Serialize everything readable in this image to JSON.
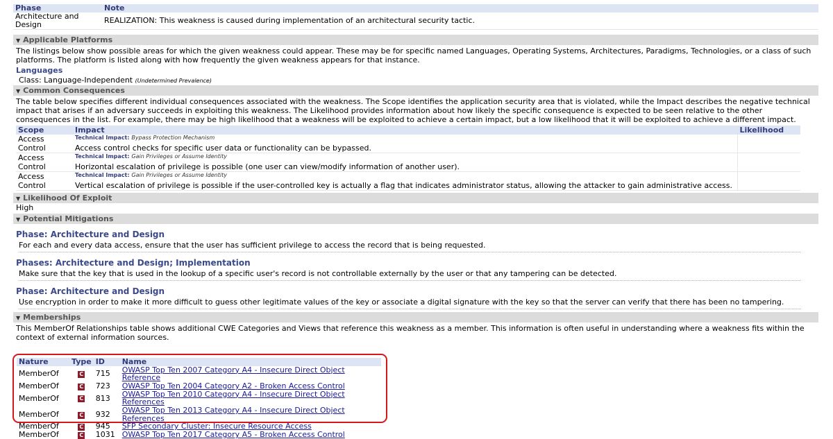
{
  "phase_table": {
    "headers": [
      "Phase",
      "Note"
    ],
    "rows": [
      [
        "Architecture and Design",
        "REALIZATION: This weakness is caused during implementation of an architectural security tactic."
      ]
    ]
  },
  "applicable_platforms": {
    "title": "Applicable Platforms",
    "description": "The listings below show possible areas for which the given weakness could appear. These may be for specific named Languages, Operating Systems, Architectures, Paradigms, Technologies, or a class of such platforms. The platform is listed along with how frequently the given weakness appears for that instance.",
    "languages_label": "Languages",
    "class_text": "Class: Language-Independent",
    "prevalence": "(Undetermined Prevalence)"
  },
  "common_consequences": {
    "title": "Common Consequences",
    "description": "The table below specifies different individual consequences associated with the weakness. The Scope identifies the application security area that is violated, while the Impact describes the negative technical impact that arises if an adversary succeeds in exploiting this weakness. The Likelihood provides information about how likely the specific consequence is expected to be seen relative to the other consequences in the list. For example, there may be high likelihood that a weakness will be exploited to achieve a certain impact, but a low likelihood that it will be exploited to achieve a different impact.",
    "headers": [
      "Scope",
      "Impact",
      "Likelihood"
    ],
    "ti_label": "Technical Impact:",
    "rows": [
      {
        "scope": "Access Control",
        "ti": "Bypass Protection Mechanism",
        "text": "Access control checks for specific user data or functionality can be bypassed."
      },
      {
        "scope": "Access Control",
        "ti": "Gain Privileges or Assume Identity",
        "text": "Horizontal escalation of privilege is possible (one user can view/modify information of another user)."
      },
      {
        "scope": "Access Control",
        "ti": "Gain Privileges or Assume Identity",
        "text": "Vertical escalation of privilege is possible if the user-controlled key is actually a flag that indicates administrator status, allowing the attacker to gain administrative access."
      }
    ]
  },
  "likelihood": {
    "title": "Likelihood Of Exploit",
    "value": "High"
  },
  "mitigations": {
    "title": "Potential Mitigations",
    "items": [
      {
        "phase": "Phase: Architecture and Design",
        "text": "For each and every data access, ensure that the user has sufficient privilege to access the record that is being requested."
      },
      {
        "phase": "Phases: Architecture and Design; Implementation",
        "text": "Make sure that the key that is used in the lookup of a specific user's record is not controllable externally by the user or that any tampering can be detected."
      },
      {
        "phase": "Phase: Architecture and Design",
        "text": "Use encryption in order to make it more difficult to guess other legitimate values of the key or associate a digital signature with the key so that the server can verify that there has been no tampering."
      }
    ]
  },
  "memberships": {
    "title": "Memberships",
    "description": "This MemberOf Relationships table shows additional CWE Categories and Views that reference this weakness as a member. This information is often useful in understanding where a weakness fits within the context of external information sources.",
    "headers": [
      "Nature",
      "Type",
      "ID",
      "Name"
    ],
    "type_glyph": "C",
    "rows": [
      {
        "nature": "MemberOf",
        "id": "715",
        "name": "OWASP Top Ten 2007 Category A4 - Insecure Direct Object Reference"
      },
      {
        "nature": "MemberOf",
        "id": "723",
        "name": "OWASP Top Ten 2004 Category A2 - Broken Access Control"
      },
      {
        "nature": "MemberOf",
        "id": "813",
        "name": "OWASP Top Ten 2010 Category A4 - Insecure Direct Object References"
      },
      {
        "nature": "MemberOf",
        "id": "932",
        "name": "OWASP Top Ten 2013 Category A4 - Insecure Direct Object References"
      },
      {
        "nature": "MemberOf",
        "id": "945",
        "name": "SFP Secondary Cluster: Insecure Resource Access"
      },
      {
        "nature": "MemberOf",
        "id": "1031",
        "name": "OWASP Top Ten 2017 Category A5 - Broken Access Control"
      }
    ]
  },
  "colors": {
    "section_bg": "#dcdcdc",
    "header_blue": "#333c7a",
    "highlight_red": "#d7151b",
    "badge": "#8b1a2a"
  }
}
